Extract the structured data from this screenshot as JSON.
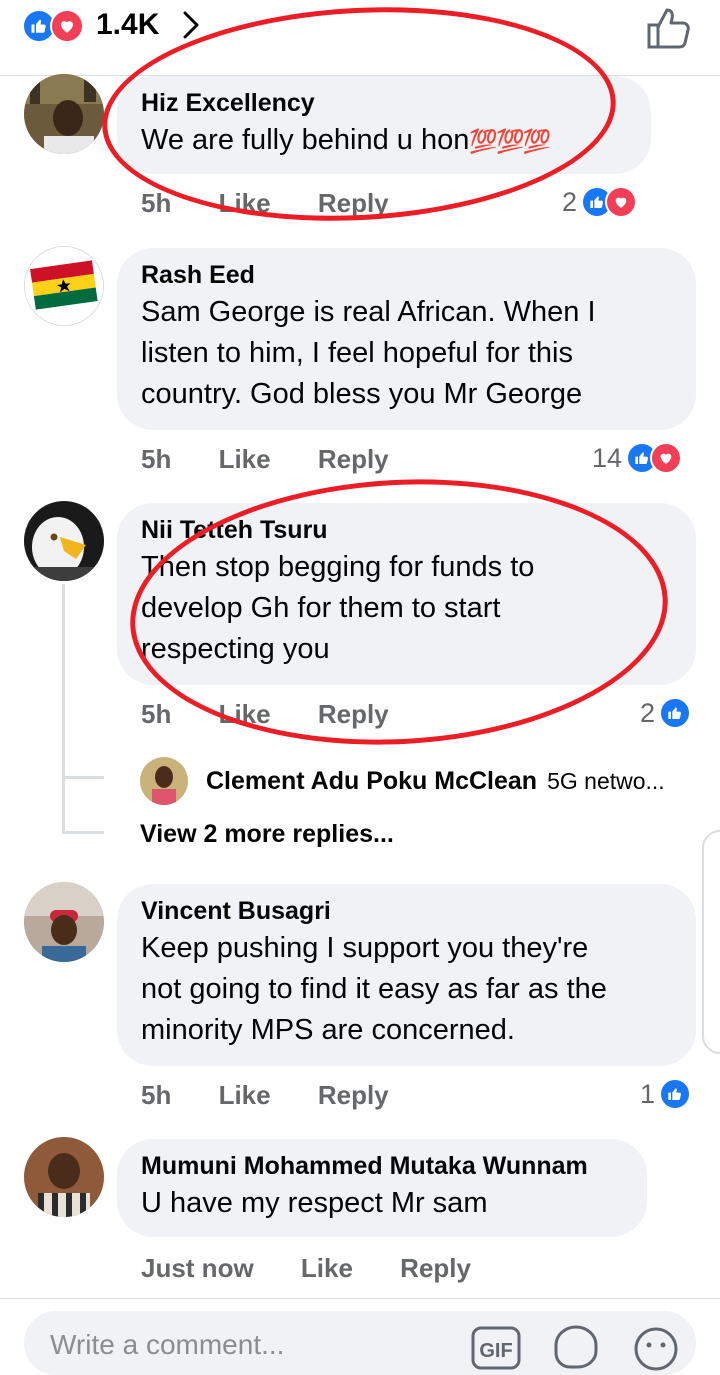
{
  "header": {
    "reaction_count": "1.4K"
  },
  "comments": [
    {
      "name": "Hiz Excellency",
      "text": "We are fully behind u hon",
      "emoji": "💯💯💯",
      "time": "5h",
      "like_label": "Like",
      "reply_label": "Reply",
      "reaction_count": "2"
    },
    {
      "name": "Rash Eed",
      "lines": [
        "Sam George is real African. When I",
        "listen to him, I feel hopeful for this",
        "country. God bless you Mr George"
      ],
      "time": "5h",
      "like_label": "Like",
      "reply_label": "Reply",
      "reaction_count": "14"
    },
    {
      "name": "Nii Tetteh Tsuru",
      "lines": [
        "Then stop begging for funds to",
        "develop Gh for them to start",
        "respecting you"
      ],
      "time": "5h",
      "like_label": "Like",
      "reply_label": "Reply",
      "reaction_count": "2"
    },
    {
      "name": "Vincent Busagri",
      "lines": [
        "Keep pushing I support you they're",
        "not going to find it easy as far as the",
        "minority MPS are concerned."
      ],
      "time": "5h",
      "like_label": "Like",
      "reply_label": "Reply",
      "reaction_count": "1"
    },
    {
      "name": "Mumuni Mohammed Mutaka Wunnam",
      "text": "U have my respect Mr sam",
      "time": "Just now",
      "like_label": "Like",
      "reply_label": "Reply"
    }
  ],
  "reply_preview": {
    "name": "Clement Adu Poku McClean",
    "text": "5G netwo..."
  },
  "view_more": "View 2 more replies...",
  "composer": {
    "placeholder": "Write a comment...",
    "gif_label": "GIF"
  },
  "colors": {
    "like_blue": "#1877f2",
    "love_red": "#f33e58",
    "annotation_red": "#ec1d24",
    "bubble_gray": "#f0f2f5"
  }
}
